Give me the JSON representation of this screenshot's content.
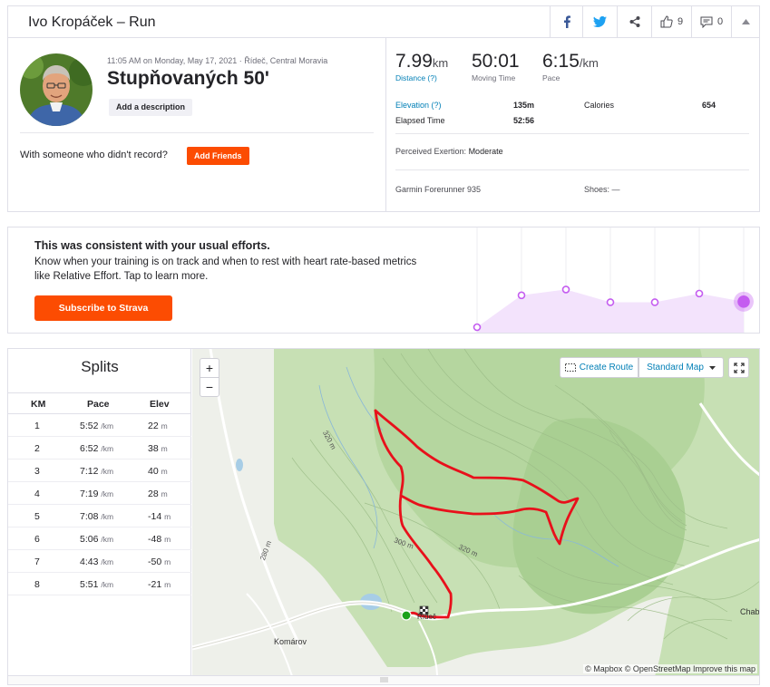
{
  "header": {
    "title": "Ivo Kropáček – Run",
    "kudos_count": "9",
    "comments_count": "0",
    "icons": [
      "facebook-icon",
      "twitter-icon",
      "share-icon",
      "thumbs-up-icon",
      "comment-icon",
      "chevron-up-icon"
    ]
  },
  "activity": {
    "meta": "11:05 AM on Monday, May 17, 2021 · Řídeč, Central Moravia",
    "name": "Stupňovaných 50'",
    "add_description": "Add a description",
    "with_someone": "With someone who didn't record?",
    "add_friends": "Add Friends"
  },
  "stats": {
    "distance_value": "7.99",
    "distance_unit": "km",
    "distance_label": "Distance (?)",
    "moving_time_value": "50:01",
    "moving_time_label": "Moving Time",
    "pace_value": "6:15",
    "pace_unit": "/km",
    "pace_label": "Pace",
    "elevation_label": "Elevation (?)",
    "elevation_value": "135m",
    "elapsed_label": "Elapsed Time",
    "elapsed_value": "52:56",
    "calories_label": "Calories",
    "calories_value": "654",
    "exertion_label": "Perceived Exertion:",
    "exertion_value": "Moderate",
    "device": "Garmin Forerunner 935",
    "shoes_label": "Shoes:",
    "shoes_value": "—"
  },
  "upsell": {
    "title": "This was consistent with your usual efforts.",
    "body": "Know when your training is on track and when to rest with heart rate-based metrics like Relative Effort. Tap to learn more.",
    "button": "Subscribe to Strava",
    "trend_levels": [
      0.0,
      0.55,
      0.65,
      0.43,
      0.43,
      0.58,
      0.44
    ],
    "accent": "#c45cf0",
    "fill": "#f3e3fc"
  },
  "splits": {
    "title": "Splits",
    "headers": [
      "KM",
      "Pace",
      "Elev"
    ],
    "pace_unit": "/km",
    "elev_unit": "m",
    "rows": [
      {
        "km": "1",
        "pace": "5:52",
        "elev": "22"
      },
      {
        "km": "2",
        "pace": "6:52",
        "elev": "38"
      },
      {
        "km": "3",
        "pace": "7:12",
        "elev": "40"
      },
      {
        "km": "4",
        "pace": "7:19",
        "elev": "28"
      },
      {
        "km": "5",
        "pace": "7:08",
        "elev": "-14"
      },
      {
        "km": "6",
        "pace": "5:06",
        "elev": "-48"
      },
      {
        "km": "7",
        "pace": "4:43",
        "elev": "-50"
      },
      {
        "km": "8",
        "pace": "5:51",
        "elev": "-21"
      }
    ]
  },
  "map": {
    "zoom_in": "+",
    "zoom_out": "−",
    "create_route": "Create Route",
    "map_style": "Standard Map",
    "labels": {
      "contour_a": "320 m",
      "contour_b": "280 m",
      "contour_c": "300 m",
      "contour_d": "320 m",
      "village": "Komárov",
      "town": "Řídeč",
      "edge_town": "Chabi"
    },
    "attribution": "© Mapbox © OpenStreetMap Improve this map",
    "route_color": "#e8101b",
    "start_color": "#1aa11a"
  }
}
